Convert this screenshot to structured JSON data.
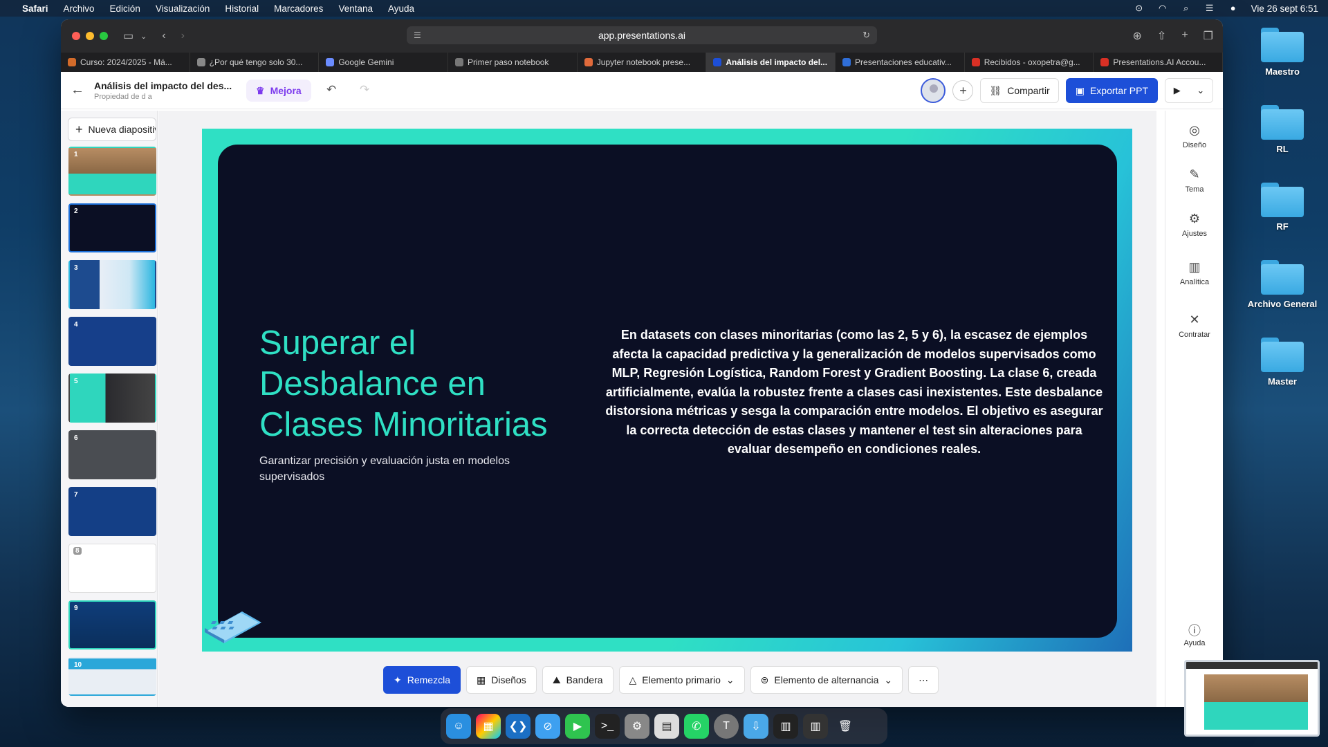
{
  "menubar": {
    "app": "Safari",
    "items": [
      "Archivo",
      "Edición",
      "Visualización",
      "Historial",
      "Marcadores",
      "Ventana",
      "Ayuda"
    ],
    "clock": "Vie 26 sept 6:51"
  },
  "desktop": [
    "Maestro",
    "RL",
    "RF",
    "Archivo General",
    "Master"
  ],
  "browser": {
    "url": "app.presentations.ai",
    "tabs": [
      {
        "label": "Curso: 2024/2025 - Má...",
        "color": "#d36b2a"
      },
      {
        "label": "¿Por qué tengo solo 30...",
        "color": "#888888"
      },
      {
        "label": "Google Gemini",
        "color": "#6b8cff"
      },
      {
        "label": "Primer paso notebook",
        "color": "#777777"
      },
      {
        "label": "Jupyter notebook prese...",
        "color": "#e06a3b"
      },
      {
        "label": "Análisis del impacto del...",
        "color": "#1d4fd8"
      },
      {
        "label": "Presentaciones educativ...",
        "color": "#2f6ed8"
      },
      {
        "label": "Recibidos - oxopetra@g...",
        "color": "#d93025"
      },
      {
        "label": "Presentations.AI Accou...",
        "color": "#d93025"
      }
    ]
  },
  "header": {
    "title": "Análisis del impacto del des...",
    "subtitle": "Propiedad de d a",
    "mejora": "Mejora",
    "share": "Compartir",
    "export": "Exportar PPT"
  },
  "sidebar": {
    "new_slide": "Nueva diapositiva",
    "slides": [
      "1",
      "2",
      "3",
      "4",
      "5",
      "6",
      "7",
      "8",
      "9",
      "10"
    ]
  },
  "slide": {
    "title": "Superar el Desbalance en Clases Minoritarias",
    "subtitle": "Garantizar precisión y evaluación justa en modelos supervisados",
    "body": "En datasets con clases minoritarias (como las 2, 5 y 6), la escasez de ejemplos afecta la capacidad predictiva y la generalización de modelos supervisados como MLP, Regresión Logística, Random Forest y Gradient Boosting. La clase 6, creada artificialmente, evalúa la robustez frente a clases casi inexistentes. Este desbalance distorsiona métricas y sesga la comparación entre modelos. El objetivo es asegurar la correcta detección de estas clases y mantener el test sin alteraciones para evaluar desempeño en condiciones reales.",
    "accent": "#2fe0c4",
    "background": "#0b0f24"
  },
  "right_panel": [
    "Diseño",
    "Tema",
    "Ajustes",
    "Analítica",
    "Contratar",
    "Ayuda"
  ],
  "toolbar": {
    "remix": "Remezcla",
    "designs": "Diseños",
    "flag": "Bandera",
    "primary": "Elemento primario",
    "alternate": "Elemento de alternancia"
  }
}
